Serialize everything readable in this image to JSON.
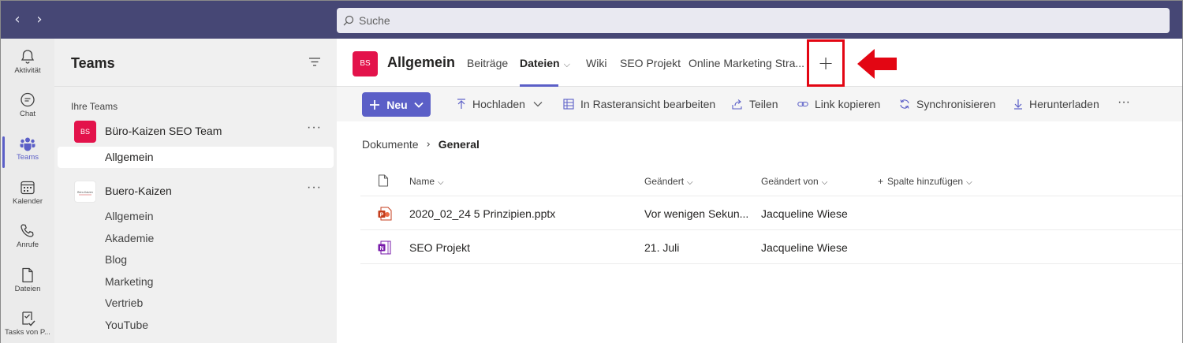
{
  "search": {
    "placeholder": "Suche"
  },
  "rail": [
    {
      "label": "Aktivität",
      "icon": "bell-icon"
    },
    {
      "label": "Chat",
      "icon": "chat-icon"
    },
    {
      "label": "Teams",
      "icon": "teams-icon",
      "active": true
    },
    {
      "label": "Kalender",
      "icon": "calendar-icon"
    },
    {
      "label": "Anrufe",
      "icon": "phone-icon"
    },
    {
      "label": "Dateien",
      "icon": "file-icon"
    },
    {
      "label": "Tasks von P...",
      "icon": "tasks-icon"
    }
  ],
  "panel": {
    "title": "Teams",
    "section": "Ihre Teams",
    "teams": [
      {
        "name": "Büro-Kaizen SEO Team",
        "avatar": "BS",
        "avatar_color": "#e3134b",
        "channels": [
          "Allgemein"
        ]
      },
      {
        "name": "Buero-Kaizen",
        "avatar": "Büro-Kaizen",
        "channels": [
          "Allgemein",
          "Akademie",
          "Blog",
          "Marketing",
          "Vertrieb",
          "YouTube"
        ]
      }
    ]
  },
  "channel": {
    "avatar": "BS",
    "title": "Allgemein",
    "tabs": [
      "Beiträge",
      "Dateien",
      "Wiki",
      "SEO Projekt",
      "Online Marketing Stra..."
    ],
    "active_tab": "Dateien",
    "add_tab": "+"
  },
  "toolbar": {
    "new_label": "Neu",
    "upload": "Hochladen",
    "grid_edit": "In Rasteransicht bearbeiten",
    "share": "Teilen",
    "copy_link": "Link kopieren",
    "sync": "Synchronisieren",
    "download": "Herunterladen",
    "more": "···"
  },
  "breadcrumb": {
    "root": "Dokumente",
    "current": "General"
  },
  "columns": {
    "name": "Name",
    "modified": "Geändert",
    "modified_by": "Geändert von",
    "add_column": "Spalte hinzufügen"
  },
  "files": [
    {
      "name": "2020_02_24 5 Prinzipien.pptx",
      "type": "powerpoint-icon",
      "modified": "Vor wenigen Sekun...",
      "modified_by": "Jacqueline Wiese"
    },
    {
      "name": "SEO Projekt",
      "type": "onenote-icon",
      "modified": "21. Juli",
      "modified_by": "Jacqueline Wiese"
    }
  ],
  "colors": {
    "accent": "#5b5fc7",
    "topbar": "#464775",
    "highlight": "#e30613"
  }
}
